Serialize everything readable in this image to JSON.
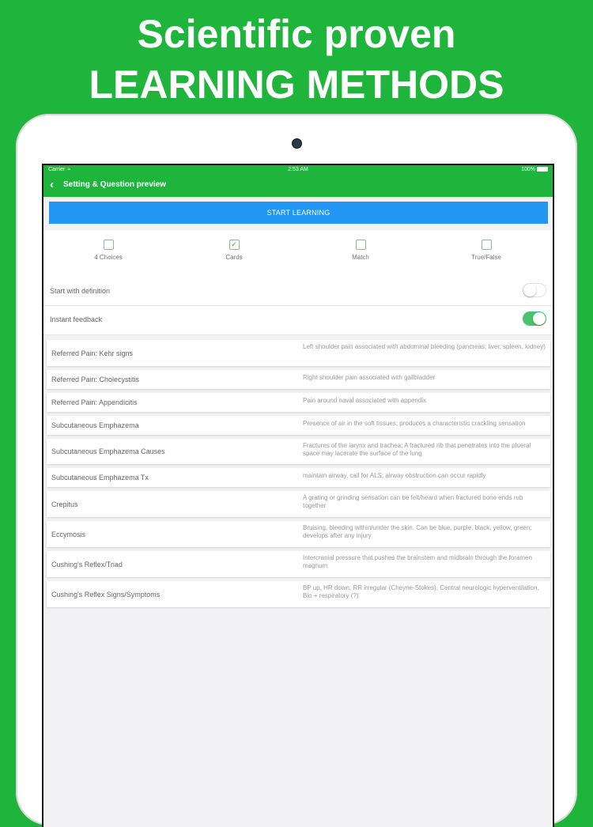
{
  "headline": {
    "line1": "Scientific proven",
    "line2": "LEARNING METHODS"
  },
  "statusbar": {
    "carrier": "Carrier",
    "time": "2:53 AM",
    "battery": "100%"
  },
  "nav": {
    "back_icon": "chevron-left-icon",
    "title": "Setting & Question preview"
  },
  "start_button": "START LEARNING",
  "modes": [
    {
      "label": "4 Choices",
      "checked": false
    },
    {
      "label": "Cards",
      "checked": true
    },
    {
      "label": "Match",
      "checked": false
    },
    {
      "label": "True/False",
      "checked": false
    }
  ],
  "settings": [
    {
      "label": "Start with definition",
      "on": false
    },
    {
      "label": "Instant feedback",
      "on": true
    }
  ],
  "colors": {
    "brand_green": "#1fb43b",
    "button_blue": "#2196f3",
    "toggle_on": "#4bc36b"
  },
  "cards": [
    {
      "term": "Referred Pain: Kehr signs",
      "definition": "Left shoulder pain associated with abdominal bleeding (pancreas, liver, spleen, kidney)"
    },
    {
      "term": "Referred Pain: Cholecystitis",
      "definition": "Right shoulder pain associated with gallbladder"
    },
    {
      "term": "Referred Pain: Appendicitis",
      "definition": "Pain around naval associated with appendix"
    },
    {
      "term": "Subcutaneous Emphazema",
      "definition": "Presence of air in the soft tissues; produces a characteristic crackling sensation"
    },
    {
      "term": "Subcutaneous Emphazema Causes",
      "definition": "Fractures of the larynx and trachea; A fractured rib that penetrates into the plueral space may lacerate the surface of the lung"
    },
    {
      "term": "Subcutaneous Emphazema Tx",
      "definition": "maintain airway, call for ALS; airway obstruction can occur rapidly"
    },
    {
      "term": "Crepitus",
      "definition": "A grating or grinding sensation can be felt/heard when fractured bone ends rub together"
    },
    {
      "term": "Eccymosis",
      "definition": "Bruising, bleeding within/under the skin. Can be blue, purple, black, yellow, green; develops after any injury"
    },
    {
      "term": "Cushing's Reflex/Triad",
      "definition": "Intercranial pressure that pushes the brainstem and midbrain through the foramen magnum"
    },
    {
      "term": "Cushing's Reflex Signs/Symptoms",
      "definition": "BP up, HR down, RR irregular (Cheyne-Stokes), Central neurologic hyperventilation, Bio + respiratory (?)"
    }
  ]
}
